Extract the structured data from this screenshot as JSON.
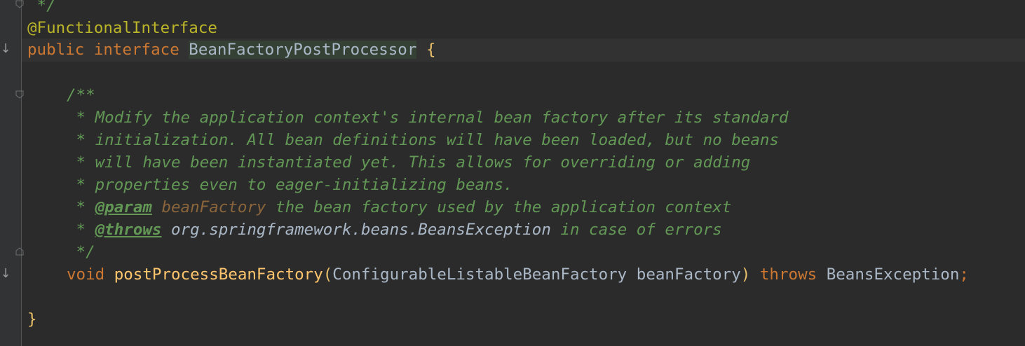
{
  "code": {
    "line_comment_end": " */",
    "annotation": "@FunctionalInterface",
    "decl": {
      "kw_public": "public",
      "kw_interface": "interface",
      "name": "BeanFactoryPostProcessor",
      "open_brace": "{"
    },
    "javadoc": {
      "open": "/**",
      "line1": " * Modify the application context's internal bean factory after its standard",
      "line2": " * initialization. All bean definitions will have been loaded, but no beans",
      "line3": " * will have been instantiated yet. This allows for overriding or adding",
      "line4": " * properties even to eager-initializing beans.",
      "param_star": " * ",
      "param_tag": "@param",
      "param_name": "beanFactory",
      "param_desc": " the bean factory used by the application context",
      "throws_star": " * ",
      "throws_tag": "@throws",
      "throws_ref": "org.springframework.beans.BeansException",
      "throws_desc": " in case of errors",
      "close": " */"
    },
    "method": {
      "kw_void": "void",
      "name": "postProcessBeanFactory",
      "open_paren": "(",
      "param_type": "ConfigurableListableBeanFactory",
      "param_name": "beanFactory",
      "close_paren": ")",
      "kw_throws": "throws",
      "exception": "BeansException",
      "semicolon": ";"
    },
    "close_brace": "}"
  },
  "gutter": {
    "implementation_marker": "↓"
  },
  "colors": {
    "background": "#2b2b2b",
    "keyword": "#cc7832",
    "annotation": "#bbb529",
    "doc_comment": "#629755",
    "method_name": "#ffc66d",
    "default_text": "#a9b7c6"
  }
}
